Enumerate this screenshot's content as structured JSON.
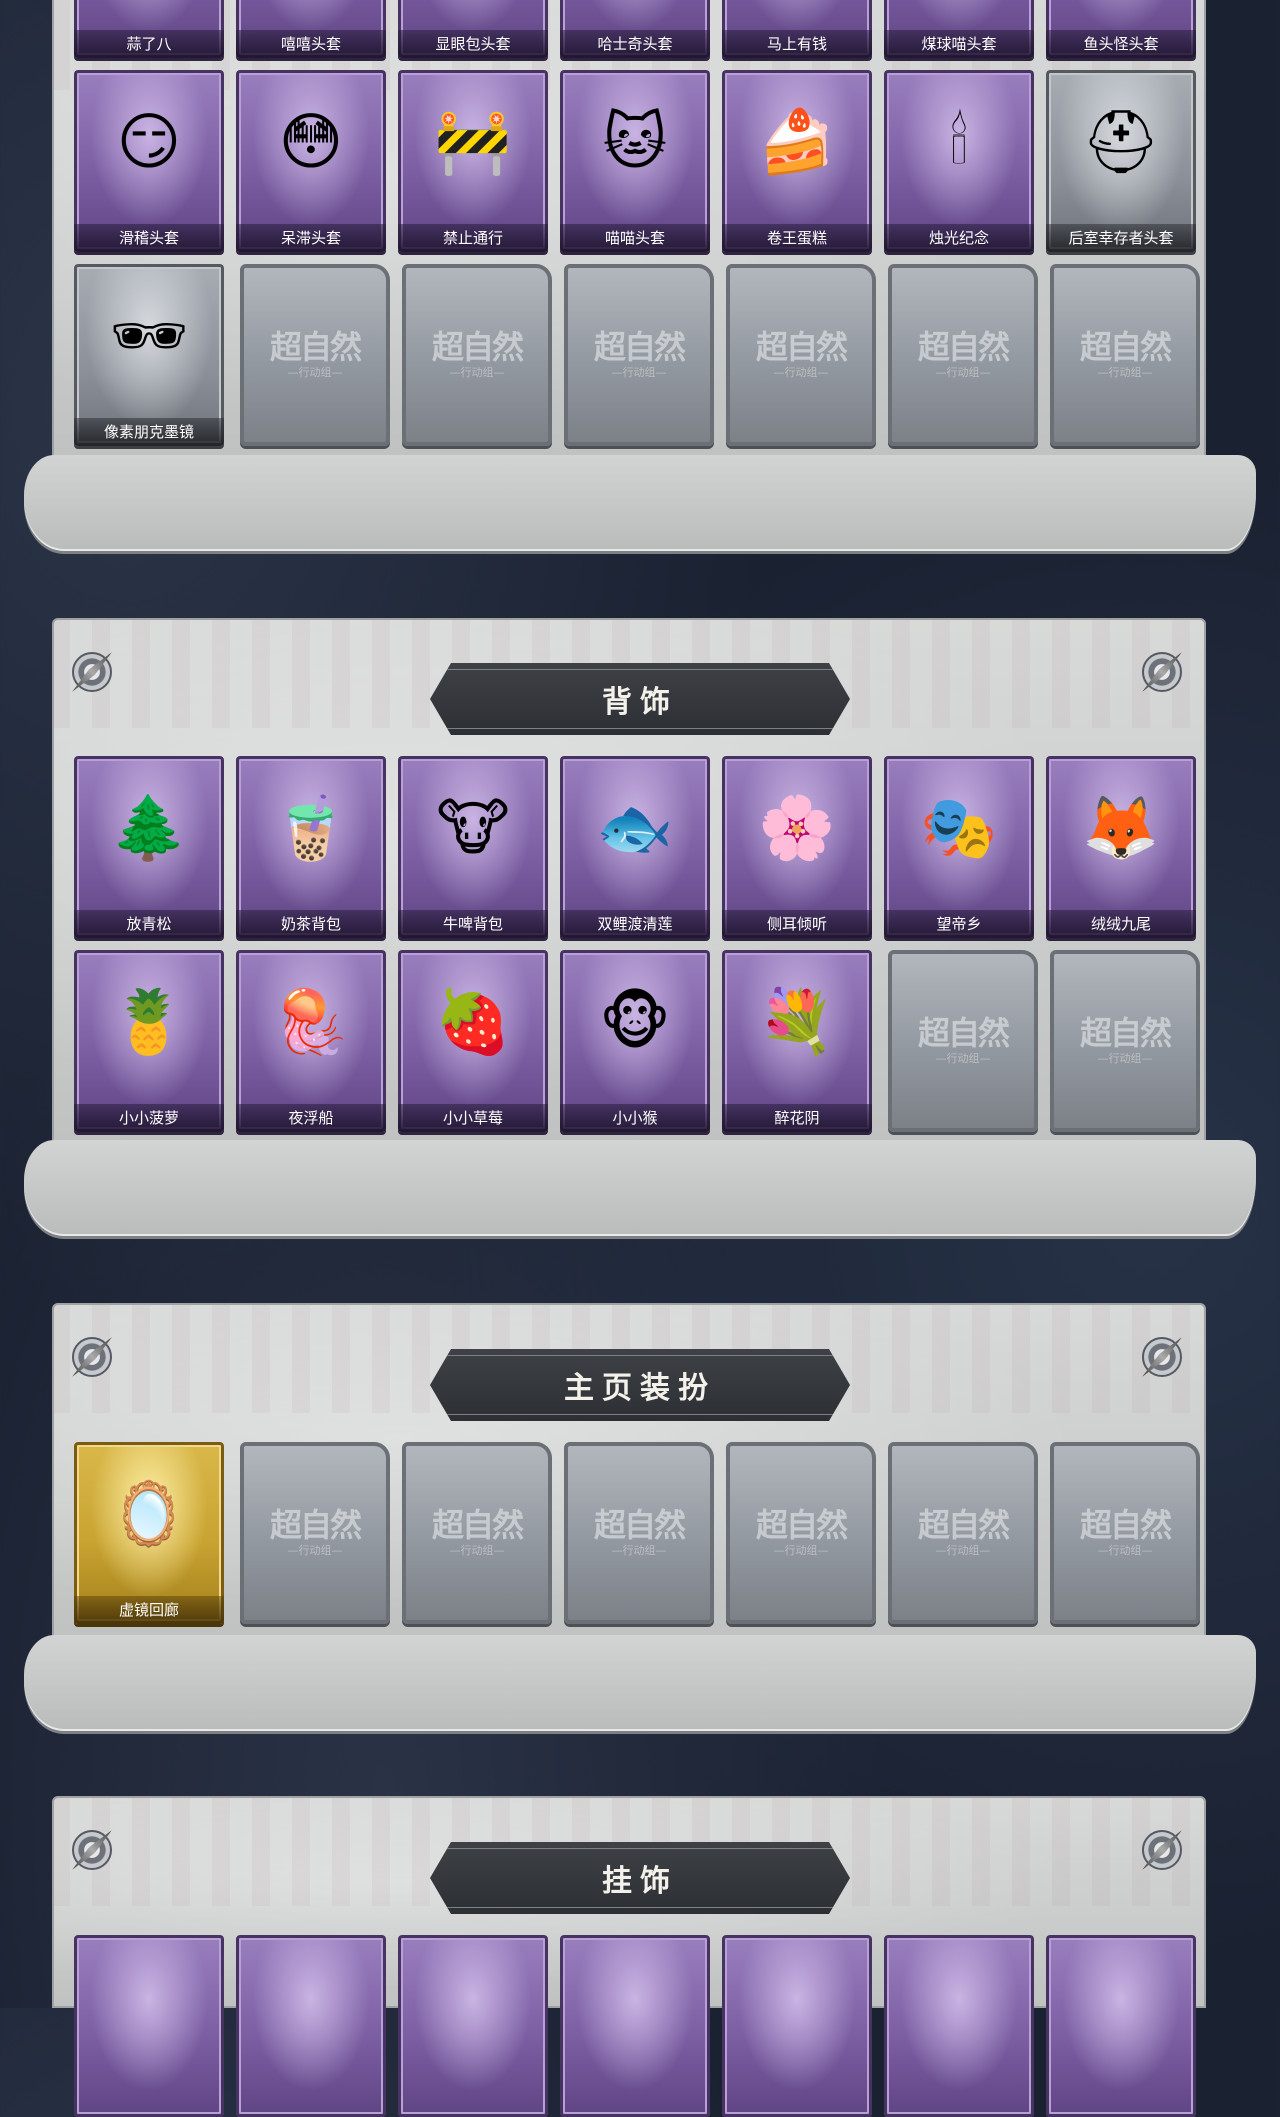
{
  "watermark": "超自然",
  "watermark_sub": "—行动组—",
  "headwear_row1": [
    "蒜了八",
    "嘻嘻头套",
    "显眼包头套",
    "哈士奇头套",
    "马上有钱",
    "煤球喵头套",
    "鱼头怪头套"
  ],
  "headwear_row2": [
    {
      "label": "滑稽头套",
      "icon": "smirk-face-icon",
      "glyph": "😏"
    },
    {
      "label": "呆滞头套",
      "icon": "blank-face-icon",
      "glyph": "😳"
    },
    {
      "label": "禁止通行",
      "icon": "traffic-cone-icon",
      "glyph": "🚧"
    },
    {
      "label": "喵喵头套",
      "icon": "cat-head-icon",
      "glyph": "🐱"
    },
    {
      "label": "卷王蛋糕",
      "icon": "roll-cake-icon",
      "glyph": "🍰"
    },
    {
      "label": "烛光纪念",
      "icon": "candle-icon",
      "glyph": "🕯"
    },
    {
      "label": "后室幸存者头套",
      "icon": "gas-mask-helmet-icon",
      "glyph": "⛑"
    }
  ],
  "headwear_row3": [
    {
      "label": "像素朋克墨镜",
      "icon": "pixel-sunglasses-icon",
      "glyph": "🕶"
    }
  ],
  "backpack": {
    "title": "背饰",
    "row1": [
      {
        "label": "放青松",
        "icon": "bonsai-pine-icon",
        "glyph": "🌲"
      },
      {
        "label": "奶茶背包",
        "icon": "milk-tea-backpack-icon",
        "glyph": "🧋"
      },
      {
        "label": "牛啤背包",
        "icon": "beer-barrel-cow-icon",
        "glyph": "🐮"
      },
      {
        "label": "双鲤渡清莲",
        "icon": "koi-lotus-icon",
        "glyph": "🐟"
      },
      {
        "label": "侧耳倾听",
        "icon": "floral-wreath-icon",
        "glyph": "🌸"
      },
      {
        "label": "望帝乡",
        "icon": "opera-character-icon",
        "glyph": "🎭"
      },
      {
        "label": "绒绒九尾",
        "icon": "nine-tail-fox-icon",
        "glyph": "🦊"
      }
    ],
    "row2": [
      {
        "label": "小小菠萝",
        "icon": "pineapple-doll-icon",
        "glyph": "🍍"
      },
      {
        "label": "夜浮船",
        "icon": "jellyfish-icon",
        "glyph": "🪼"
      },
      {
        "label": "小小草莓",
        "icon": "strawberry-doll-icon",
        "glyph": "🍓"
      },
      {
        "label": "小小猴",
        "icon": "monkey-doll-icon",
        "glyph": "🐵"
      },
      {
        "label": "醉花阴",
        "icon": "flower-fan-icon",
        "glyph": "💐"
      }
    ]
  },
  "homepage": {
    "title": "主页装扮",
    "row1": [
      {
        "label": "虚镜回廊",
        "icon": "mirror-card-icon",
        "glyph": "🪞"
      }
    ]
  },
  "pendant": {
    "title": "挂饰"
  },
  "colors": {
    "purple_card": "#7c5fa3",
    "gold_card": "#c9a331",
    "silver_card": "#8b9098",
    "empty_card": "#959ba2",
    "banner": "#2c2f34"
  }
}
